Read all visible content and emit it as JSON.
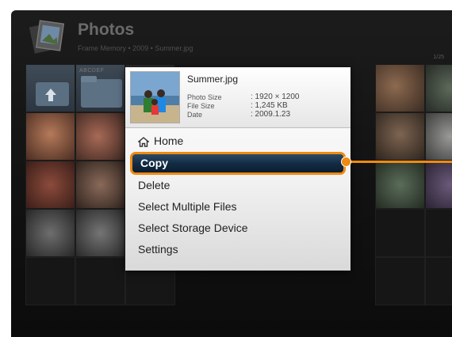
{
  "app": {
    "title": "Photos",
    "breadcrumb": "Frame Memory • 2009 • Summer.jpg",
    "counter": "1/25",
    "icon": "photos-stack-icon"
  },
  "grid": {
    "folder_label": "ABCDEF"
  },
  "info_panel": {
    "file_name": "Summer.jpg",
    "rows": [
      {
        "label": "Photo Size",
        "value": ": 1920 × 1200"
      },
      {
        "label": "File Size",
        "value": ": 1,245 KB"
      },
      {
        "label": "Date",
        "value": ": 2009.1.23"
      }
    ]
  },
  "menu": {
    "items": [
      {
        "label": "Home",
        "icon": "home-icon"
      },
      {
        "label": "Copy"
      },
      {
        "label": "Delete"
      },
      {
        "label": "Select Multiple Files"
      },
      {
        "label": "Select Storage Device"
      },
      {
        "label": "Settings"
      }
    ],
    "selected_index": 1
  },
  "colors": {
    "accent": "#f08a12",
    "selection": "#132c44",
    "background": "#111111"
  }
}
